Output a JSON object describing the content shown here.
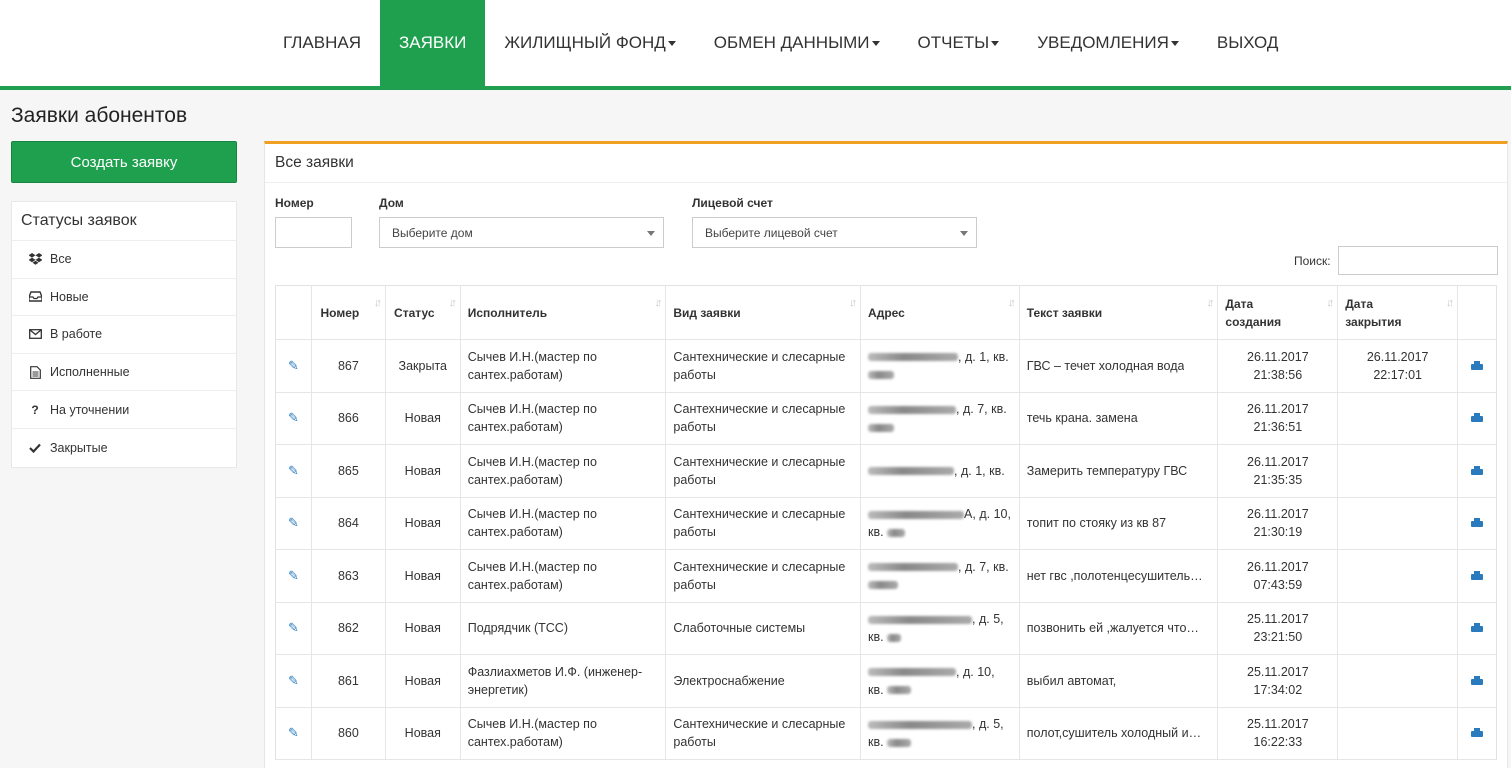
{
  "nav": {
    "items": [
      {
        "label": "ГЛАВНАЯ",
        "dropdown": false
      },
      {
        "label": "ЗАЯВКИ",
        "dropdown": false,
        "active": true
      },
      {
        "label": "ЖИЛИЩНЫЙ ФОНД",
        "dropdown": true
      },
      {
        "label": "ОБМЕН ДАННЫМИ",
        "dropdown": true
      },
      {
        "label": "ОТЧЕТЫ",
        "dropdown": true
      },
      {
        "label": "УВЕДОМЛЕНИЯ",
        "dropdown": true
      },
      {
        "label": "ВЫХОД",
        "dropdown": false
      }
    ],
    "accent_color": "#1fa04f"
  },
  "page_title": "Заявки абонентов",
  "sidebar": {
    "create_label": "Создать заявку",
    "statuses_title": "Статусы заявок",
    "statuses": [
      {
        "icon": "dropbox-icon",
        "label": "Все"
      },
      {
        "icon": "inbox-icon",
        "label": "Новые"
      },
      {
        "icon": "envelope-icon",
        "label": "В работе"
      },
      {
        "icon": "document-icon",
        "label": "Исполненные"
      },
      {
        "icon": "question-icon",
        "label": "На уточнении"
      },
      {
        "icon": "check-icon",
        "label": "Закрытые"
      }
    ]
  },
  "panel": {
    "title": "Все заявки",
    "accent_color": "#f0a020",
    "filters": {
      "number_label": "Номер",
      "house_label": "Дом",
      "house_placeholder": "Выберите дом",
      "account_label": "Лицевой счет",
      "account_placeholder": "Выберите лицевой счет",
      "search_label": "Поиск:"
    }
  },
  "table": {
    "columns": [
      "Номер",
      "Статус",
      "Исполнитель",
      "Вид заявки",
      "Адрес",
      "Текст заявки",
      "Дата создания",
      "Дата закрытия"
    ],
    "rows": [
      {
        "number": "867",
        "status": "Закрыта",
        "executor": "Сычев И.Н.(мастер по сантех.работам)",
        "type": "Сантехнические и слесарные работы",
        "addr_tail": ", д. 1, кв.",
        "text": "ГВС – течет холодная вода",
        "created": "26.11.2017 21:38:56",
        "closed": "26.11.2017 22:17:01"
      },
      {
        "number": "866",
        "status": "Новая",
        "executor": "Сычев И.Н.(мастер по сантех.работам)",
        "type": "Сантехнические и слесарные работы",
        "addr_tail": ", д. 7, кв.",
        "text": "течь крана. замена",
        "created": "26.11.2017 21:36:51",
        "closed": ""
      },
      {
        "number": "865",
        "status": "Новая",
        "executor": "Сычев И.Н.(мастер по сантех.работам)",
        "type": "Сантехнические и слесарные работы",
        "addr_tail": ", д. 1, кв.",
        "text": "Замерить температуру ГВС",
        "created": "26.11.2017 21:35:35",
        "closed": ""
      },
      {
        "number": "864",
        "status": "Новая",
        "executor": "Сычев И.Н.(мастер по сантех.работам)",
        "type": "Сантехнические и слесарные работы",
        "addr_tail": "А, д. 10, кв.",
        "text": "топит по стояку из кв 87",
        "created": "26.11.2017 21:30:19",
        "closed": ""
      },
      {
        "number": "863",
        "status": "Новая",
        "executor": "Сычев И.Н.(мастер по сантех.работам)",
        "type": "Сантехнические и слесарные работы",
        "addr_tail": ", д. 7, кв.",
        "text": "нет гвс ,полотенцесушитель…",
        "created": "26.11.2017 07:43:59",
        "closed": ""
      },
      {
        "number": "862",
        "status": "Новая",
        "executor": "Подрядчик (ТСС)",
        "type": "Слаботочные системы",
        "addr_tail": ", д. 5, кв.",
        "text": "позвонить ей ,жалуется что…",
        "created": "25.11.2017 23:21:50",
        "closed": ""
      },
      {
        "number": "861",
        "status": "Новая",
        "executor": "Фазлиахметов И.Ф. (инженер-энергетик)",
        "type": "Электроснабжение",
        "addr_tail": ", д. 10, кв.",
        "text": "выбил автомат,",
        "created": "25.11.2017 17:34:02",
        "closed": ""
      },
      {
        "number": "860",
        "status": "Новая",
        "executor": "Сычев И.Н.(мастер по сантех.работам)",
        "type": "Сантехнические и слесарные работы",
        "addr_tail": ", д. 5, кв.",
        "text": "полот,сушитель холодный и…",
        "created": "25.11.2017 16:22:33",
        "closed": ""
      }
    ]
  }
}
